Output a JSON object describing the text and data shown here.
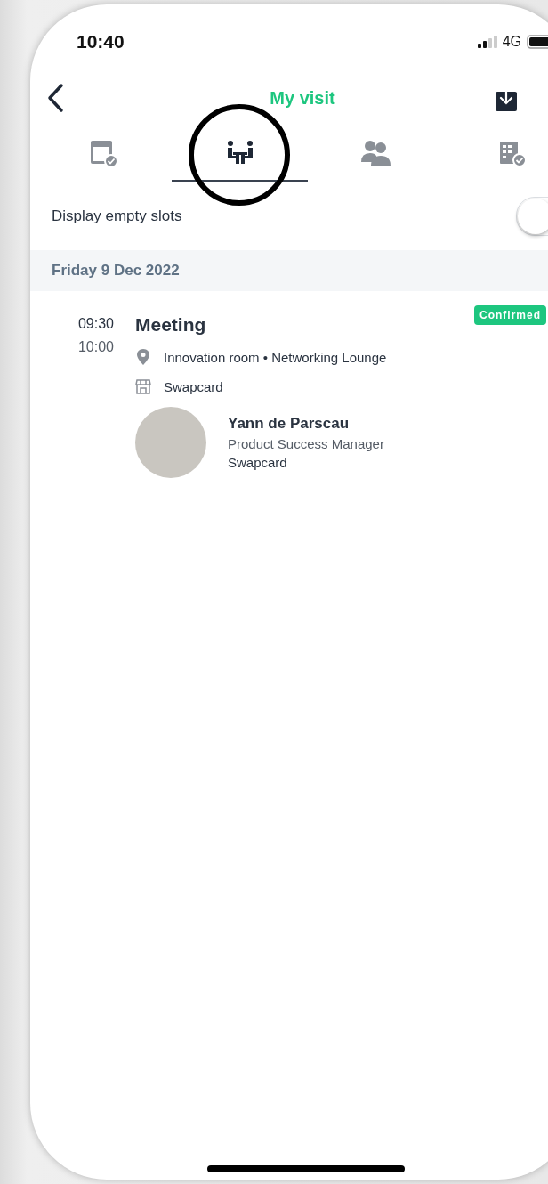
{
  "status_bar": {
    "time": "10:40",
    "network": "4G"
  },
  "header": {
    "title": "My visit"
  },
  "tabs": [
    {
      "selected": false
    },
    {
      "selected": true
    },
    {
      "selected": false
    },
    {
      "selected": false
    }
  ],
  "empty_slots": {
    "label": "Display empty slots",
    "on": false
  },
  "day": {
    "date": "Friday 9 Dec 2022"
  },
  "events": [
    {
      "start": "09:30",
      "end": "10:00",
      "title": "Meeting",
      "status": "Confirmed",
      "location": "Innovation room • Networking Lounge",
      "company": "Swapcard",
      "attendee": {
        "name": "Yann de Parscau",
        "role": "Product Success Manager",
        "company": "Swapcard"
      }
    }
  ]
}
